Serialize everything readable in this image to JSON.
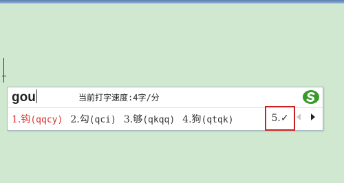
{
  "ime": {
    "composition": "gou",
    "speed_text": "当前打字速度:4字/分",
    "candidates": [
      {
        "index": "1.",
        "char": "钩",
        "code": "(qqcy)"
      },
      {
        "index": "2.",
        "char": "勾",
        "code": "(qci)"
      },
      {
        "index": "3.",
        "char": "够",
        "code": "(qkqq)"
      },
      {
        "index": "4.",
        "char": "狗",
        "code": "(qtqk)"
      },
      {
        "index": "5.",
        "char": "✓",
        "code": ""
      }
    ],
    "selected_color": "#d9302a",
    "highlight_color": "#cc1f1f",
    "logo_color": "#3a9a2a",
    "logo_icon": "sogou-s-logo-icon",
    "prev_icon": "page-prev-icon",
    "next_icon": "page-next-icon"
  },
  "desktop_bg": "#cfe8cf"
}
